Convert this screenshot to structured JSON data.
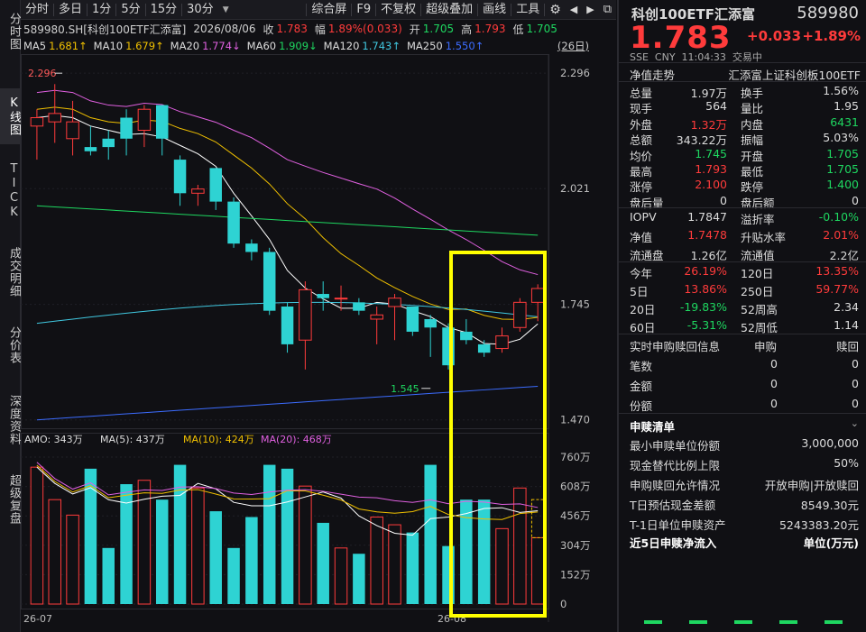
{
  "vtabs": [
    "分时图",
    "K线图",
    "TICK",
    "成交明细",
    "分价表",
    "深度资料",
    "超级复盘"
  ],
  "toolbar": {
    "left": [
      "分时",
      "多日",
      "1分",
      "5分",
      "15分",
      "30分"
    ],
    "right": [
      "综合屏",
      "F9",
      "不复权",
      "超级叠加",
      "画线",
      "工具"
    ]
  },
  "info": {
    "code": "589980.SH[科创100ETF汇添富]",
    "date": "2026/08/06",
    "close_label": "收",
    "close": "1.783",
    "amp_label": "幅",
    "amp": "1.89%(0.033)",
    "open_label": "开",
    "open": "1.705",
    "high_label": "高",
    "high": "1.793",
    "low_label": "低",
    "low": "1.705"
  },
  "ma": [
    {
      "name": "MA5",
      "value": "1.681↑",
      "color": "#ffffff"
    },
    {
      "name": "MA10",
      "value": "1.679↑",
      "color": "#f0c000"
    },
    {
      "name": "MA20",
      "value": "1.774↓",
      "color": "#e060e0"
    },
    {
      "name": "MA60",
      "value": "1.909↓",
      "color": "#1ed760"
    },
    {
      "name": "MA120",
      "value": "1.743↑",
      "color": "#40c8e0"
    },
    {
      "name": "MA250",
      "value": "1.550↑",
      "color": "#3c6cff"
    }
  ],
  "ma_days": "(26日)",
  "chart_data": {
    "type": "candlestick",
    "price_axis_ticks": [
      "2.296",
      "2.021",
      "1.745",
      "1.470"
    ],
    "price_range": [
      1.45,
      2.32
    ],
    "high_marker": "2.296",
    "low_marker": "1.545",
    "x_labels": [
      "26-07",
      "26-08"
    ],
    "candles": [
      {
        "o": 2.17,
        "c": 2.19,
        "h": 2.21,
        "l": 2.09
      },
      {
        "o": 2.18,
        "c": 2.2,
        "h": 2.27,
        "l": 2.13
      },
      {
        "o": 2.14,
        "c": 2.18,
        "h": 2.23,
        "l": 2.1
      },
      {
        "o": 2.12,
        "c": 2.11,
        "h": 2.17,
        "l": 2.1
      },
      {
        "o": 2.14,
        "c": 2.12,
        "h": 2.16,
        "l": 2.09
      },
      {
        "o": 2.19,
        "c": 2.14,
        "h": 2.21,
        "l": 2.1
      },
      {
        "o": 2.16,
        "c": 2.21,
        "h": 2.22,
        "l": 2.12
      },
      {
        "o": 2.22,
        "c": 2.14,
        "h": 2.22,
        "l": 2.1
      },
      {
        "o": 2.09,
        "c": 2.01,
        "h": 2.1,
        "l": 1.98
      },
      {
        "o": 2.01,
        "c": 2.02,
        "h": 2.03,
        "l": 1.98
      },
      {
        "o": 2.07,
        "c": 1.99,
        "h": 2.07,
        "l": 1.97
      },
      {
        "o": 1.99,
        "c": 1.89,
        "h": 2.0,
        "l": 1.88
      },
      {
        "o": 1.89,
        "c": 1.87,
        "h": 1.9,
        "l": 1.85
      },
      {
        "o": 1.87,
        "c": 1.73,
        "h": 1.88,
        "l": 1.72
      },
      {
        "o": 1.74,
        "c": 1.65,
        "h": 1.75,
        "l": 1.63
      },
      {
        "o": 1.66,
        "c": 1.78,
        "h": 1.8,
        "l": 1.59
      },
      {
        "o": 1.77,
        "c": 1.76,
        "h": 1.8,
        "l": 1.73
      },
      {
        "o": 1.76,
        "c": 1.76,
        "h": 1.79,
        "l": 1.73
      },
      {
        "o": 1.75,
        "c": 1.73,
        "h": 1.76,
        "l": 1.72
      },
      {
        "o": 1.71,
        "c": 1.72,
        "h": 1.74,
        "l": 1.65
      },
      {
        "o": 1.74,
        "c": 1.76,
        "h": 1.77,
        "l": 1.66
      },
      {
        "o": 1.74,
        "c": 1.68,
        "h": 1.74,
        "l": 1.67
      },
      {
        "o": 1.71,
        "c": 1.69,
        "h": 1.72,
        "l": 1.62
      },
      {
        "o": 1.69,
        "c": 1.6,
        "h": 1.7,
        "l": 1.59
      },
      {
        "o": 1.68,
        "c": 1.66,
        "h": 1.71,
        "l": 1.65
      },
      {
        "o": 1.65,
        "c": 1.63,
        "h": 1.66,
        "l": 1.62
      },
      {
        "o": 1.64,
        "c": 1.67,
        "h": 1.69,
        "l": 1.63
      },
      {
        "o": 1.69,
        "c": 1.75,
        "h": 1.76,
        "l": 1.68
      },
      {
        "o": 1.75,
        "c": 1.783,
        "h": 1.793,
        "l": 1.705
      }
    ],
    "ma_series": [
      {
        "name": "MA5",
        "color": "#ffffff"
      },
      {
        "name": "MA10",
        "color": "#f0c000"
      },
      {
        "name": "MA20",
        "color": "#e060e0"
      },
      {
        "name": "MA60",
        "color": "#1ed760"
      },
      {
        "name": "MA120",
        "color": "#40c8e0"
      },
      {
        "name": "MA250",
        "color": "#3c6cff"
      }
    ],
    "volume": {
      "label_amo": "AMO: 343万",
      "label_ma5": "MA(5): 437万",
      "label_ma10": "MA(10): 424万",
      "label_ma20": "MA(20): 468万",
      "axis_ticks": [
        "760万",
        "608万",
        "456万",
        "304万",
        "152万",
        "0"
      ],
      "max": 760,
      "values": [
        708,
        540,
        460,
        700,
        290,
        620,
        640,
        540,
        720,
        600,
        480,
        290,
        450,
        720,
        700,
        610,
        420,
        290,
        260,
        450,
        410,
        370,
        720,
        300,
        540,
        540,
        390,
        600,
        343
      ]
    }
  },
  "quote": {
    "name": "科创100ETF汇添富",
    "code": "589980",
    "price": "1.783",
    "change": "+0.033",
    "change_pct": "+1.89%",
    "meta": "SSE  CNY  11:04:33  交易中",
    "nav_label": "净值走势",
    "index_name": "汇添富上证科创板100ETF"
  },
  "stats": [
    [
      "总量",
      "1.97万",
      "w",
      "换手",
      "1.56%",
      "w"
    ],
    [
      "现手",
      "564",
      "w",
      "量比",
      "1.95",
      "w"
    ],
    [
      "外盘",
      "1.32万",
      "r",
      "内盘",
      "6431",
      "g"
    ],
    [
      "总额",
      "343.22万",
      "w",
      "振幅",
      "5.03%",
      "w"
    ],
    [
      "均价",
      "1.745",
      "g",
      "开盘",
      "1.705",
      "g"
    ],
    [
      "最高",
      "1.793",
      "r",
      "最低",
      "1.705",
      "g"
    ],
    [
      "涨停",
      "2.100",
      "r",
      "跌停",
      "1.400",
      "g"
    ],
    [
      "盘后量",
      "0",
      "w",
      "盘后额",
      "0",
      "w"
    ]
  ],
  "iopv": [
    [
      "IOPV",
      "1.7847",
      "w",
      "溢折率",
      "-0.10%",
      "g"
    ],
    [
      "净值",
      "1.7478",
      "r",
      "升贴水率",
      "2.01%",
      "r"
    ],
    [
      "流通盘",
      "1.26亿",
      "w",
      "流通值",
      "2.2亿",
      "w"
    ]
  ],
  "perf": [
    [
      "今年",
      "26.19%",
      "r",
      "120日",
      "13.35%",
      "r"
    ],
    [
      "5日",
      "13.86%",
      "r",
      "250日",
      "59.77%",
      "r"
    ],
    [
      "20日",
      "-19.83%",
      "g",
      "52周高",
      "2.34",
      "w"
    ],
    [
      "60日",
      "-5.31%",
      "g",
      "52周低",
      "1.14",
      "w"
    ]
  ],
  "redeem": {
    "title": "实时申购赎回信息",
    "col1": "申购",
    "col2": "赎回",
    "rows": [
      [
        "笔数",
        "0",
        "0"
      ],
      [
        "金额",
        "0",
        "0"
      ],
      [
        "份额",
        "0",
        "0"
      ]
    ]
  },
  "list": {
    "title": "申赎清单",
    "rows": [
      [
        "最小申赎单位份额",
        "3,000,000"
      ],
      [
        "现金替代比例上限",
        "50%"
      ],
      [
        "申购赎回允许情况",
        "开放申购|开放赎回"
      ],
      [
        "T日预估现金差额",
        "8549.30元"
      ],
      [
        "T-1日单位申赎资产",
        "5243383.20元"
      ]
    ]
  },
  "flow": {
    "title": "近5日申赎净流入",
    "unit": "单位(万元)"
  }
}
